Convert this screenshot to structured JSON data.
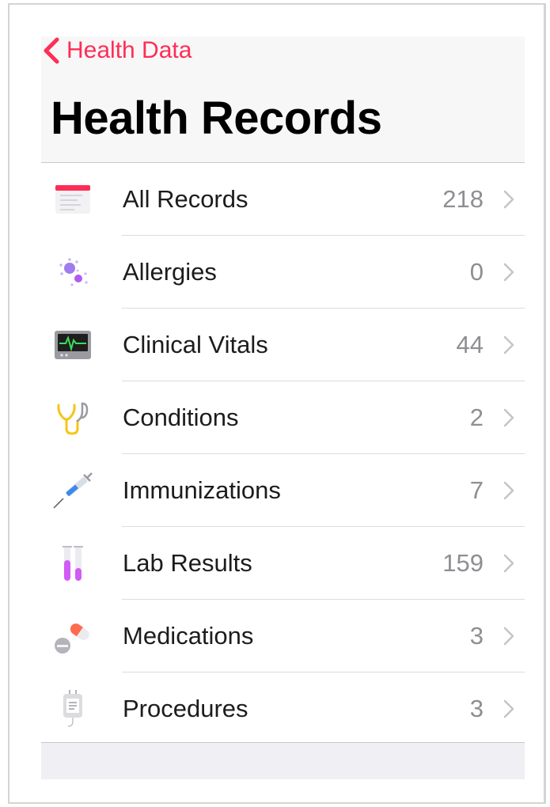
{
  "nav": {
    "back_label": "Health Data",
    "title": "Health Records"
  },
  "colors": {
    "accent": "#ff2d55",
    "count": "#8e8e93"
  },
  "categories": [
    {
      "icon": "records-list-icon",
      "label": "All Records",
      "count": "218"
    },
    {
      "icon": "allergen-icon",
      "label": "Allergies",
      "count": "0"
    },
    {
      "icon": "vitals-monitor-icon",
      "label": "Clinical Vitals",
      "count": "44"
    },
    {
      "icon": "stethoscope-icon",
      "label": "Conditions",
      "count": "2"
    },
    {
      "icon": "syringe-icon",
      "label": "Immunizations",
      "count": "7"
    },
    {
      "icon": "test-tubes-icon",
      "label": "Lab Results",
      "count": "159"
    },
    {
      "icon": "pills-icon",
      "label": "Medications",
      "count": "3"
    },
    {
      "icon": "iv-bag-icon",
      "label": "Procedures",
      "count": "3"
    }
  ]
}
